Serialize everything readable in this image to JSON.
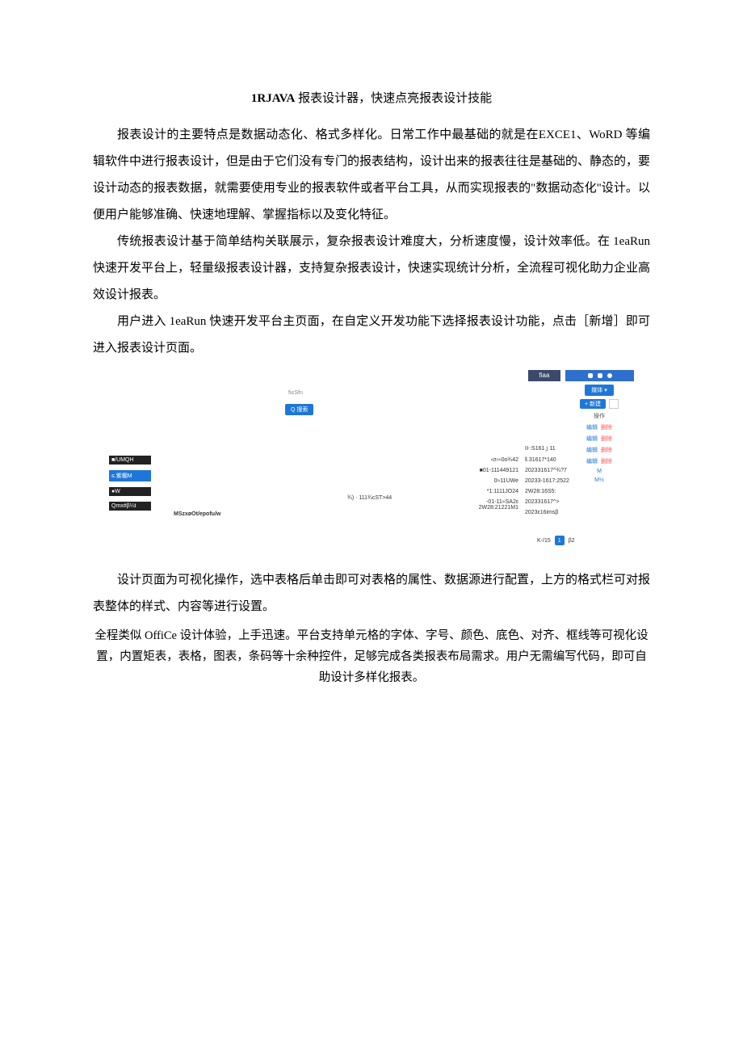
{
  "title_bold": "1RJAVA",
  "title_rest": " 报表设计器，快速点亮报表设计技能",
  "para1_a": "报表设计的主要特点是数据动态化、格式多样化。日常工作中最基础的就是在",
  "para1_b": "EXCE1、WoRD",
  "para1_c": " 等编辑软件中进行报表设计，但是由于它们没有专门的报表结构，设计出来的报表往往是基础的、静态的，要设计动态的报表数据，就需要使用专业的报表软件或者平台工具，从而实现报表的\"数据动态化\"设计。以便用户能够准确、快速地理解、掌握指标以及变化特征。",
  "para2_a": "传统报表设计基于简单结构关联展示，复杂报表设计难度大，分析速度慢，设计效率低。在 ",
  "para2_b": "1eaRun",
  "para2_c": " 快速开发平台上，轻量级报表设计器，支持复杂报表设计，快速实现统计分析，全流程可视化助力企业高效设计报表。",
  "para3_a": "用户进入 ",
  "para3_b": "1eaRun",
  "para3_c": " 快速开发平台主页面，在自定义开发功能下选择报表设计功能，点击［新增］即可进入报表设计页面。",
  "para4": "设计页面为可视化操作，选中表格后单击即可对表格的属性、数据源进行配置，上方的格式栏可对报表整体的样式、内容等进行设置。",
  "para5_a": "全程类似 ",
  "para5_b": "OffiCe",
  "para5_c": " 设计体验，上手迅速。平台支持单元格的字体、字号、颜色、底色、对齐、框线等可视化设置，内置矩表，表格，图表，条码等十余种控件，足够完成各类报表布局需求。用户无需编写代码，即可自助设计多样化报表。",
  "shot": {
    "topbar": "fiaa",
    "small_label": "fi≤Sfn",
    "search": "Q 搜索",
    "leftcol": [
      "■/UMQH",
      "≤.紫棚M",
      "●W",
      "Qmx#β¼t"
    ],
    "ms": "MSzxøOt/epofu/w",
    "midtag": "¾) · 111¾cST>44",
    "col_a": [
      "‹σ›≈0o¾42",
      "■01-111449121",
      "0≈11UWe",
      "*1:1111JO24",
      "-01-11≈SA2ε 2W28:21221M1"
    ],
    "col_b": [
      "⊪:S161 ꠸ 11",
      "‖.31617*140",
      "202331617^¾?7",
      "20233-1617:2522",
      "2W28:16S5:",
      "202331617^>",
      "2023ε16imsβ"
    ],
    "right": {
      "btn1": "媒体 ▾",
      "add": "+ 新建",
      "op": "操作",
      "act_edit": "编辑",
      "act_del": "删除",
      "m1": "M",
      "m2": "M½"
    },
    "pager": {
      "label": "K-/15",
      "page": "1",
      "sz": "β2"
    }
  }
}
